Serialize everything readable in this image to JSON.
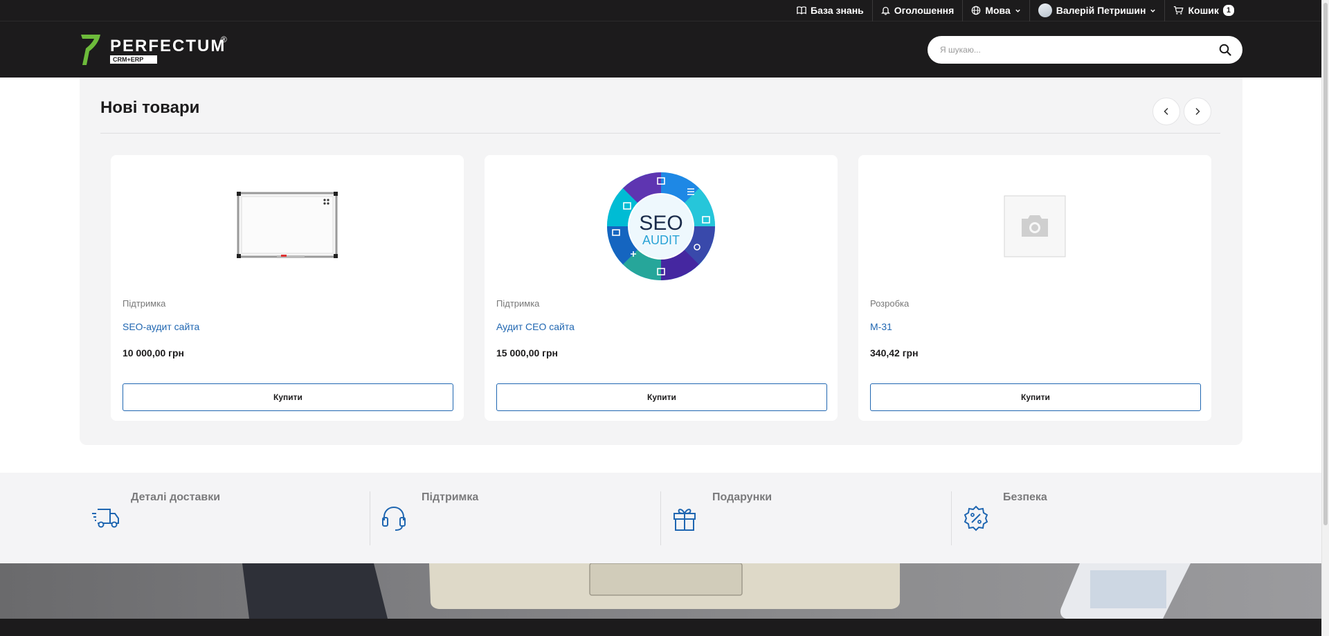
{
  "topbar": {
    "knowledge_base": "База знань",
    "announcements": "Оголошення",
    "language": "Мова",
    "user": "Валерій Петришин",
    "cart": "Кошик",
    "cart_count": "1"
  },
  "header": {
    "logo_text": "PERFECTUM",
    "logo_sub": "CRM+ERP",
    "logo_mark": "®",
    "search_placeholder": "Я шукаю..."
  },
  "products": {
    "title": "Нові товари",
    "items": [
      {
        "category": "Підтримка",
        "name": "SEO-аудит сайта",
        "price": "10 000,00 грн",
        "buy": "Купити",
        "image": "whiteboard"
      },
      {
        "category": "Підтримка",
        "name": "Аудит СЕО сайта",
        "price": "15 000,00 грн",
        "buy": "Купити",
        "image": "seo-audit"
      },
      {
        "category": "Розробка",
        "name": "М-31",
        "price": "340,42 грн",
        "buy": "Купити",
        "image": "placeholder-camera"
      }
    ]
  },
  "seo_image": {
    "line1": "SEO",
    "line2": "AUDIT"
  },
  "features": [
    {
      "title": "Деталі доставки",
      "icon": "delivery-truck-icon"
    },
    {
      "title": "Підтримка",
      "icon": "headset-icon"
    },
    {
      "title": "Подарунки",
      "icon": "gift-icon"
    },
    {
      "title": "Безпека",
      "icon": "discount-badge-icon"
    }
  ],
  "colors": {
    "dark": "#1c1b1c",
    "accent": "#1f66b1",
    "panel": "#f4f4f5"
  }
}
